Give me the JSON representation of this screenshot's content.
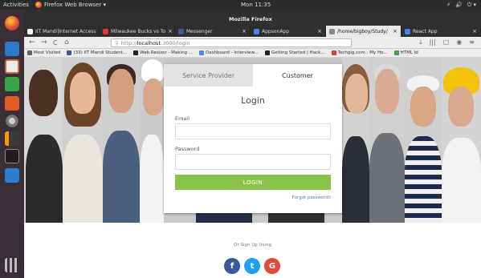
{
  "system_bar": {
    "activities": "Activities",
    "app_menu": "Firefox Web Browser ▾",
    "clock": "Mon 11:35",
    "tray": [
      "⚡",
      "🔊",
      "⏻ ▾"
    ]
  },
  "window": {
    "title": "Mozilla Firefox"
  },
  "tabs": [
    {
      "label": "IIT Mandi|Internet Access",
      "color": "#ffffff",
      "active": false
    },
    {
      "label": "Milwaukee Bucks vs To",
      "color": "#e53935",
      "active": false
    },
    {
      "label": "Messenger",
      "color": "#3b5998",
      "active": false
    },
    {
      "label": "AppsonApp",
      "color": "#4285f4",
      "active": false
    },
    {
      "label": "/home/bigboy/Study/",
      "color": "#dddddd",
      "active": true
    },
    {
      "label": "React App",
      "color": "#4285f4",
      "active": false
    }
  ],
  "nav": {
    "back": "←",
    "forward": "→",
    "reload": "C",
    "home": "⌂",
    "url_scheme": "http://",
    "url_host": "localhost",
    "url_path": ":3000/login",
    "right_icons": [
      "⤓",
      "|||",
      "▢",
      "◉",
      "≡"
    ]
  },
  "bookmarks": [
    {
      "label": "Most Visited",
      "color": "#666666"
    },
    {
      "label": "(33) IIT Mandi Student...",
      "color": "#3b5998"
    },
    {
      "label": "Web Resizer - Making ...",
      "color": "#222222"
    },
    {
      "label": "Dashboard - Interview...",
      "color": "#4a90e2"
    },
    {
      "label": "Getting Started | Hack...",
      "color": "#222222"
    },
    {
      "label": "Techgig.com : My Ho...",
      "color": "#e53935"
    },
    {
      "label": "HTML Id",
      "color": "#43a047"
    }
  ],
  "login": {
    "tab_provider": "Service Provider",
    "tab_customer": "Customer",
    "title": "Login",
    "email_label": "Email",
    "email_value": "",
    "password_label": "Password",
    "password_value": "",
    "button": "LOGIN",
    "forgot": "Forgot password?"
  },
  "social": {
    "heading": "Or Sign Up Using",
    "buttons": [
      {
        "name": "facebook",
        "glyph": "f",
        "color": "#3b5998"
      },
      {
        "name": "twitter",
        "glyph": "t",
        "color": "#1da1f2"
      },
      {
        "name": "google",
        "glyph": "G",
        "color": "#dd4b39"
      }
    ]
  },
  "launcher_icons": [
    "firefox-icon",
    "writer-icon",
    "calc-icon",
    "impress-icon",
    "software-center-icon",
    "settings-icon",
    "sublime-icon",
    "terminal-icon",
    "vscode-icon",
    "apps-grid-icon"
  ]
}
